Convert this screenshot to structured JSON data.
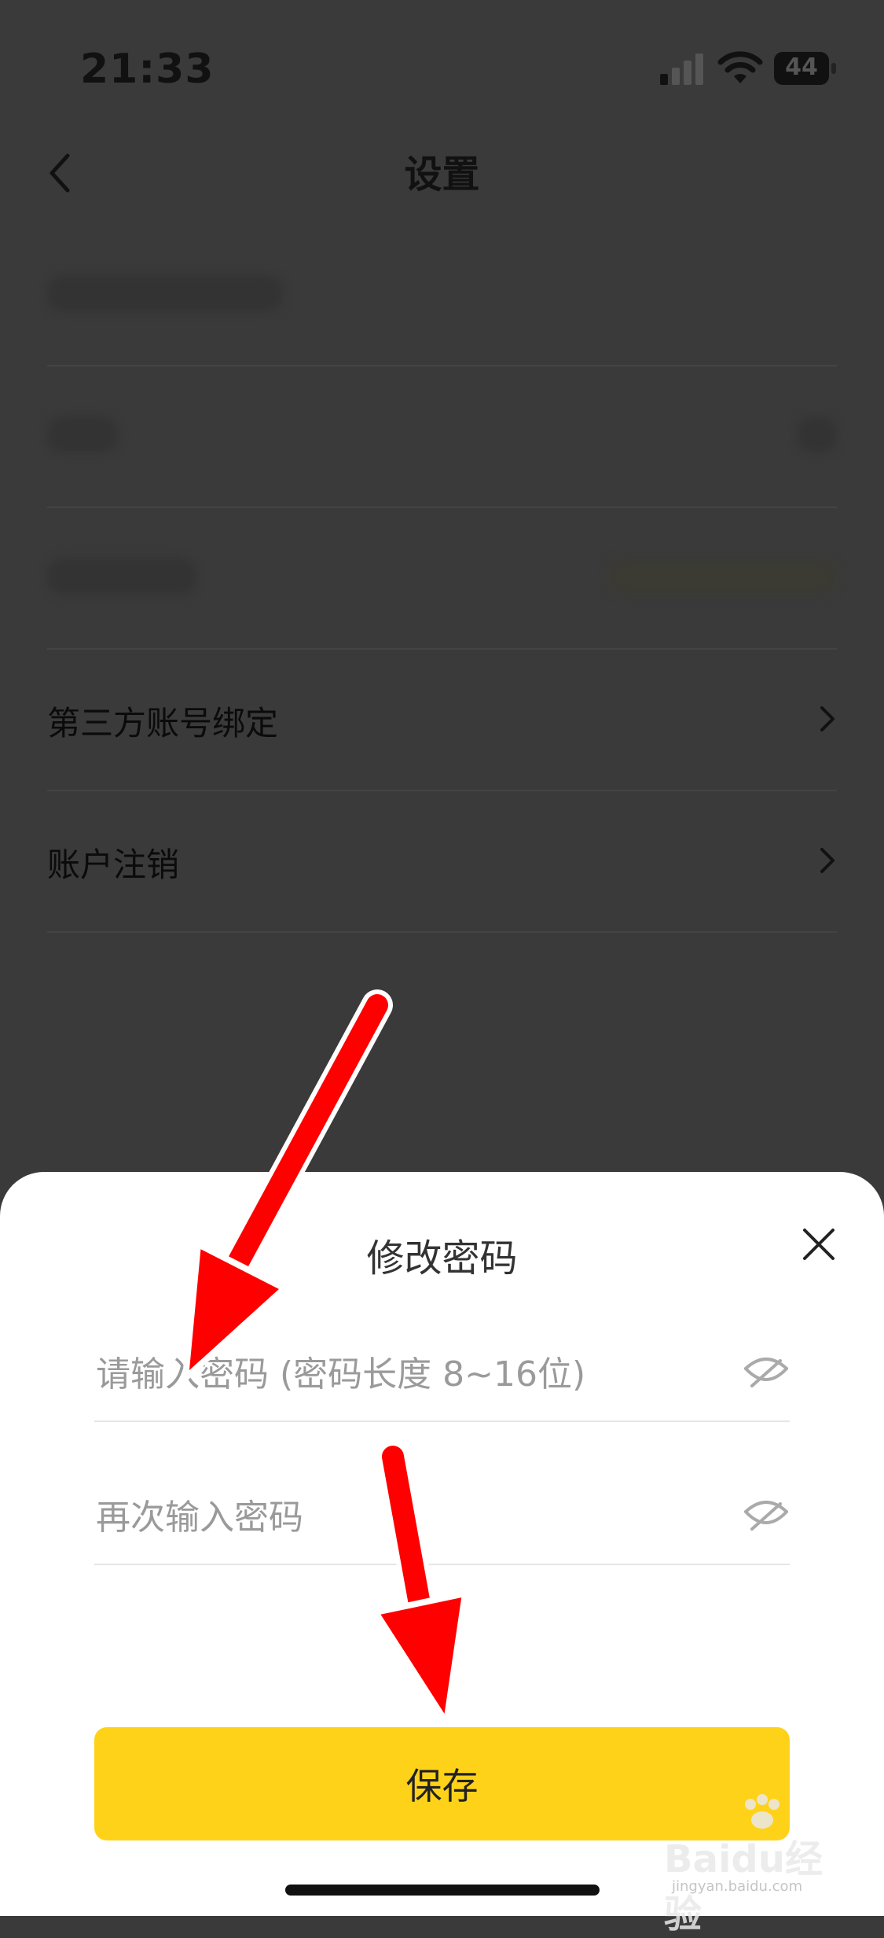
{
  "status_bar": {
    "time": "21:33",
    "battery": "44"
  },
  "nav": {
    "title": "设置"
  },
  "settings": {
    "items": [
      {
        "label": "第三方账号绑定"
      },
      {
        "label": "账户注销"
      }
    ]
  },
  "sheet": {
    "title": "修改密码",
    "password_placeholder": "请输入密码 (密码长度 8~16位)",
    "confirm_placeholder": "再次输入密码",
    "save_label": "保存"
  },
  "watermark": {
    "brand": "Baidu经验",
    "sub": "jingyan.baidu.com"
  },
  "colors": {
    "accent": "#ffd21a",
    "arrow": "#ff0000",
    "overlay": "#3a3a3a"
  }
}
